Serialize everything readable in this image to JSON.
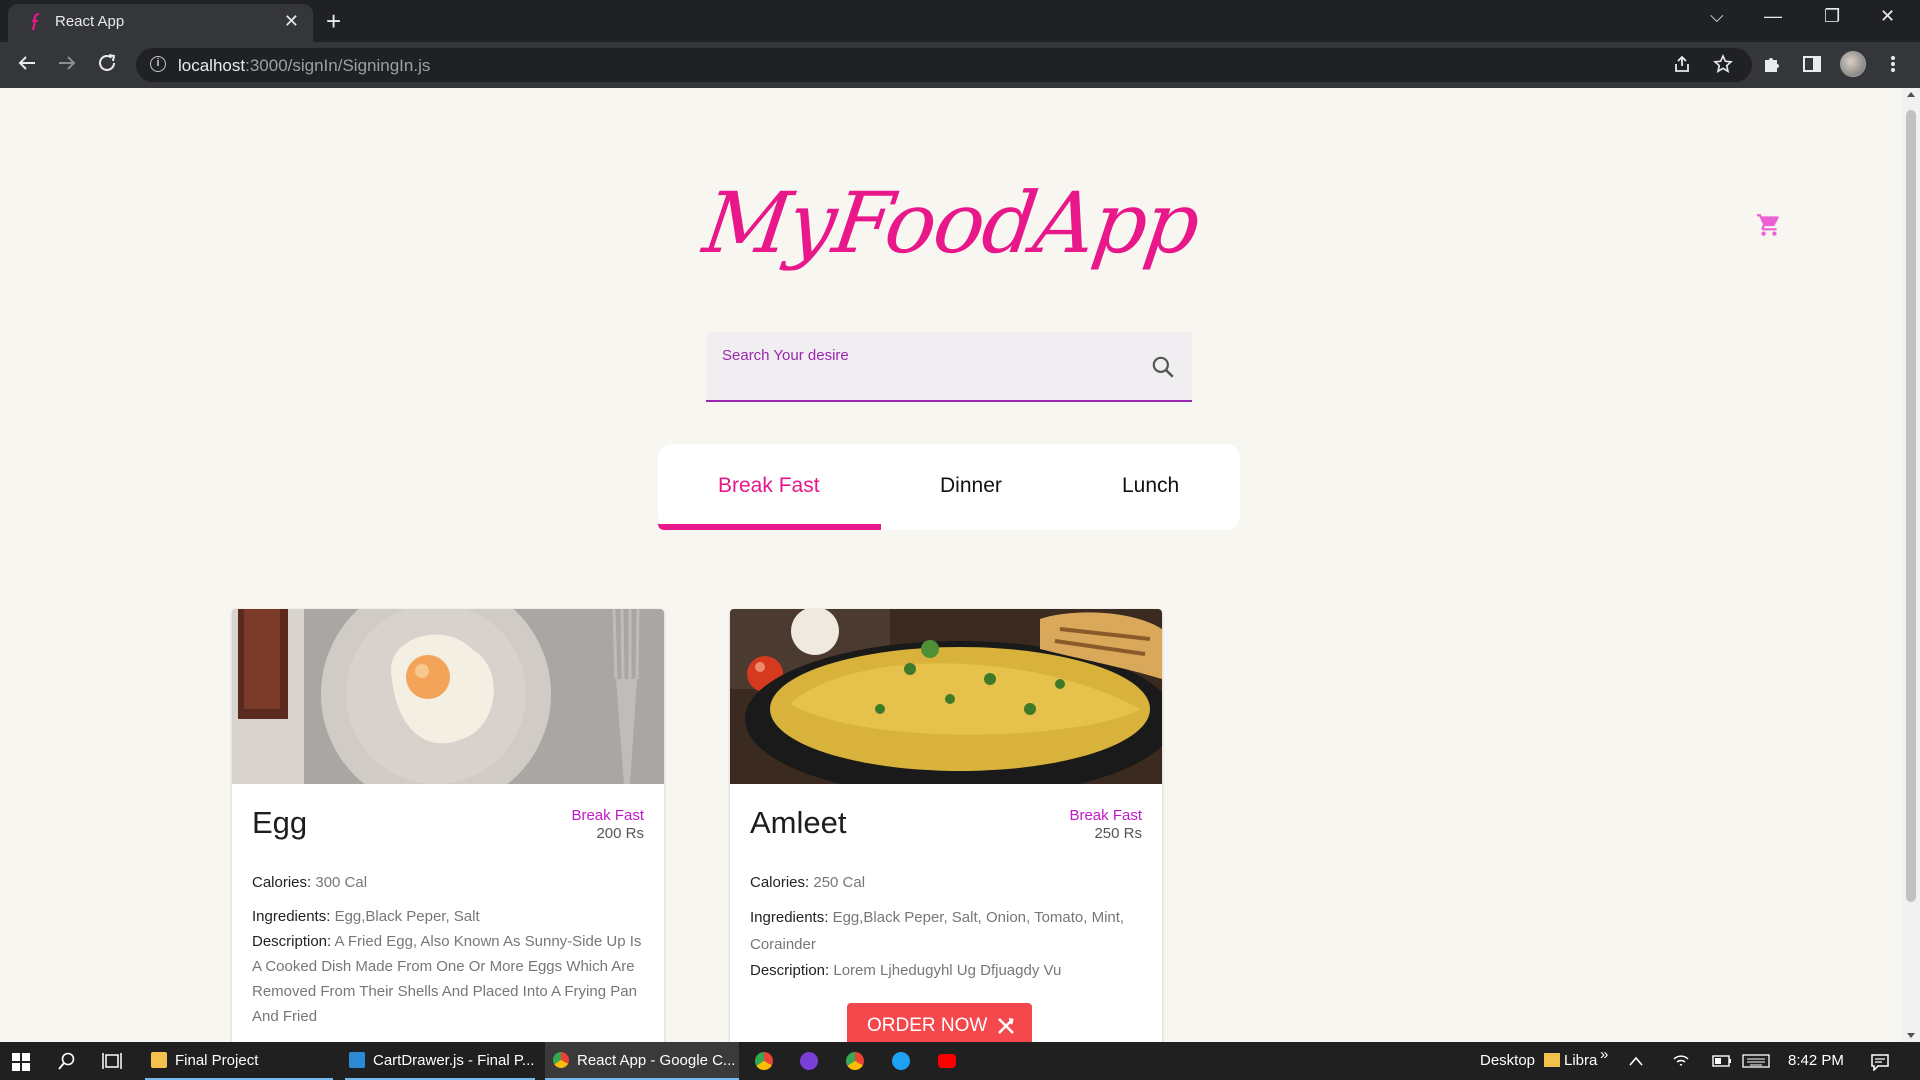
{
  "browser": {
    "tab_title": "React App",
    "tab_close": "✕",
    "new_tab": "+",
    "url_host": "localhost",
    "url_path": ":3000/signIn/SigningIn.js",
    "window_controls": [
      "⌵",
      "—",
      "❐",
      "✕"
    ]
  },
  "app": {
    "logo": "MyFoodApp",
    "cart_icon": "cart-icon",
    "accent": "#e8178a",
    "search": {
      "label": "Search Your desire",
      "value": ""
    },
    "tabs": [
      {
        "label": "Break Fast",
        "active": true
      },
      {
        "label": "Dinner",
        "active": false
      },
      {
        "label": "Lunch",
        "active": false
      }
    ],
    "cards": [
      {
        "name": "Egg",
        "category": "Break Fast",
        "price": "200 Rs",
        "calories_label": "Calories:",
        "calories": "300 Cal",
        "ingredients_label": "Ingredients:",
        "ingredients": "Egg,Black Peper, Salt",
        "description_label": "Description:",
        "description": "A Fried Egg, Also Known As Sunny-Side Up Is A Cooked Dish Made From One Or More Eggs Which Are Removed From Their Shells And Placed Into A Frying Pan And Fried"
      },
      {
        "name": "Amleet",
        "category": "Break Fast",
        "price": "250 Rs",
        "calories_label": "Calories:",
        "calories": "250 Cal",
        "ingredients_label": "Ingredients:",
        "ingredients": "Egg,Black Peper, Salt, Onion, Tomato, Mint, Corainder",
        "description_label": "Description:",
        "description": "Lorem Ljhedugyhl Ug Dfjuagdy Vu",
        "order_button": "ORDER NOW"
      }
    ]
  },
  "taskbar": {
    "apps": [
      {
        "label": "Final Project"
      },
      {
        "label": "CartDrawer.js - Final P..."
      },
      {
        "label": "React App - Google C..."
      }
    ],
    "desktop": "Desktop",
    "library": "Libra",
    "chevrons": "»",
    "time": "8:42 PM"
  }
}
